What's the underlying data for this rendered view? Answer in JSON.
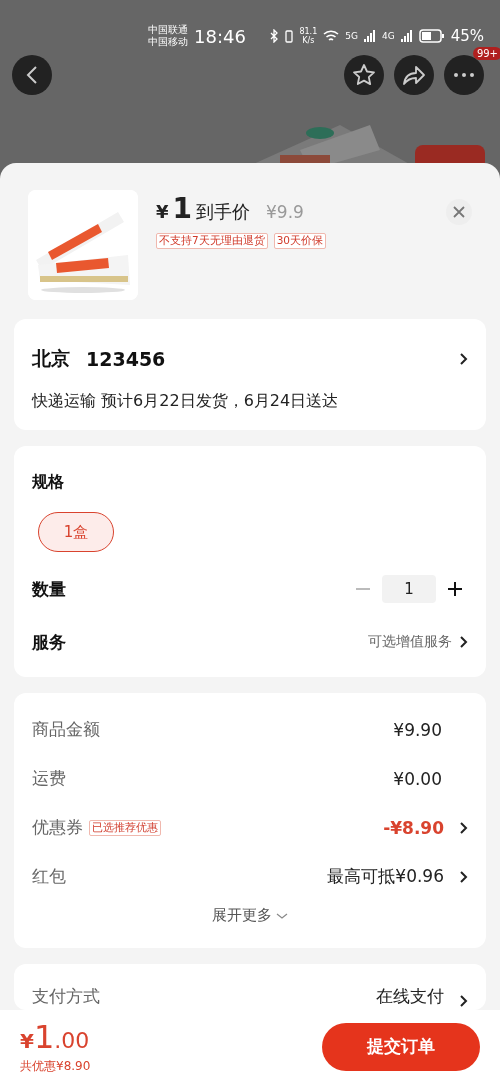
{
  "status_bar": {
    "carriers": [
      "中国联通",
      "中国移动"
    ],
    "time": "18:46",
    "net_speed": [
      "81.1",
      "K/s"
    ],
    "signals": [
      "5G",
      "4G"
    ],
    "battery": "45%"
  },
  "nav": {
    "badge": "99+"
  },
  "product": {
    "currency": "¥",
    "price": "1",
    "price_label": "到手价",
    "original_price": "¥9.9",
    "tags": [
      "不支持7天无理由退货",
      "30天价保"
    ]
  },
  "address": {
    "city": "北京",
    "code": "123456",
    "delivery": "快递运输 预计6月22日发货，6月24日送达"
  },
  "spec": {
    "title": "规格",
    "options": [
      {
        "label": "1盒",
        "selected": true
      }
    ]
  },
  "quantity": {
    "label": "数量",
    "value": "1",
    "minus_disabled": true
  },
  "service": {
    "label": "服务",
    "value": "可选增值服务"
  },
  "price_rows": [
    {
      "kind": "amount",
      "label": "商品金额",
      "value": "¥9.90"
    },
    {
      "kind": "amount",
      "label": "运费",
      "value": "¥0.00"
    },
    {
      "kind": "discount",
      "label": "优惠券",
      "tag": "已选推荐优惠",
      "value": "-¥8.90"
    },
    {
      "kind": "link",
      "label": "红包",
      "value": "最高可抵¥0.96"
    }
  ],
  "expand": "展开更多",
  "payment": {
    "label": "支付方式",
    "value": "在线支付"
  },
  "footer": {
    "currency": "¥",
    "integer": "1",
    "decimal": ".00",
    "saving": "共优惠¥8.90",
    "submit": "提交订单"
  }
}
